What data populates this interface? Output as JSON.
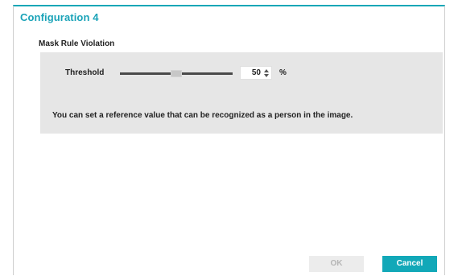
{
  "dialog": {
    "title": "Configuration 4",
    "section_title": "Mask Rule Violation",
    "accent_color": "#17a7b7"
  },
  "threshold": {
    "label": "Threshold",
    "value": "50",
    "slider_fraction": 0.5,
    "unit": "%",
    "spinner_icons": [
      "chevron-up-icon",
      "chevron-down-icon"
    ]
  },
  "help_text": "You can set a reference value that can be recognized as a person in the image.",
  "buttons": {
    "ok_label": "OK",
    "ok_enabled": false,
    "cancel_label": "Cancel"
  }
}
